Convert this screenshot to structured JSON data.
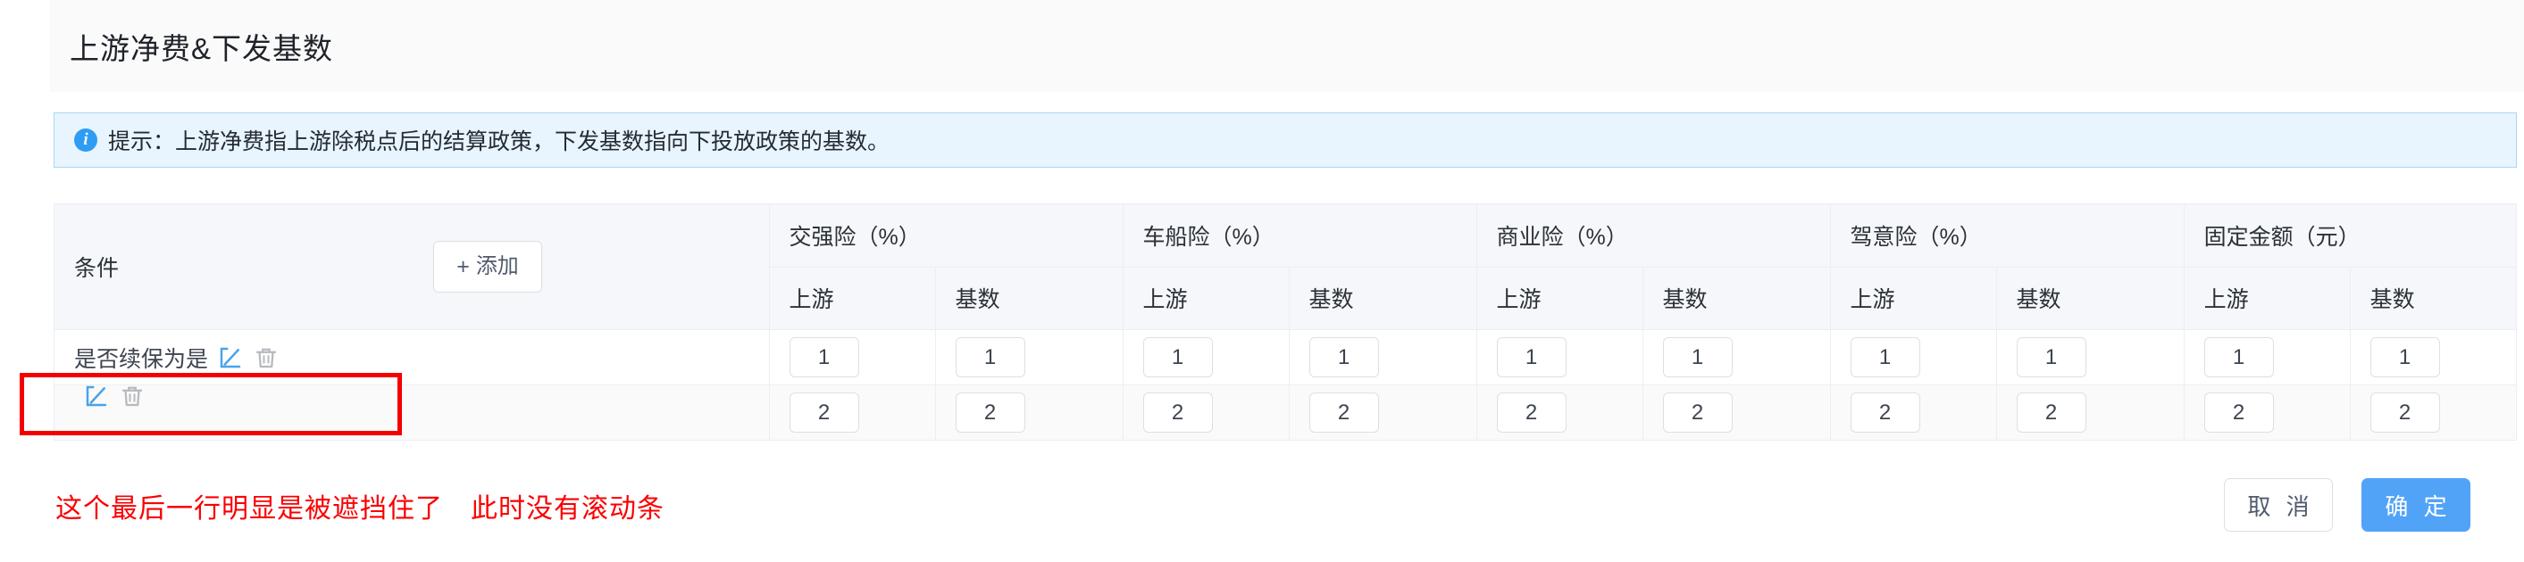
{
  "dialog": {
    "title": "上游净费&下发基数"
  },
  "banner": {
    "icon": "info-circle-icon",
    "text": "提示：上游净费指上游除税点后的结算政策，下发基数指向下投放政策的基数。"
  },
  "table": {
    "condition_column": {
      "label": "条件",
      "add_button": {
        "plus": "+",
        "label": "添加"
      }
    },
    "group_headers": [
      "交强险（%）",
      "车船险（%）",
      "商业险（%）",
      "驾意险（%）",
      "固定金额（元）"
    ],
    "sub_headers": [
      "上游",
      "基数"
    ],
    "sub_header_cells": [
      "上游",
      "基数",
      "上游",
      "基数",
      "上游",
      "基数",
      "上游",
      "基数",
      "上游",
      "基数"
    ],
    "rows": [
      {
        "condition": "是否续保为是",
        "edit_icon": "edit-pencil-icon",
        "delete_icon": "trash-icon",
        "values": [
          "1",
          "1",
          "1",
          "1",
          "1",
          "1",
          "1",
          "1",
          "1",
          "1"
        ]
      },
      {
        "condition": "",
        "edit_icon": "edit-pencil-icon",
        "delete_icon": "trash-icon",
        "values": [
          "2",
          "2",
          "2",
          "2",
          "2",
          "2",
          "2",
          "2",
          "2",
          "2"
        ]
      }
    ]
  },
  "annotation": {
    "note": "这个最后一行明显是被遮挡住了　此时没有滚动条",
    "box_color": "#f40000",
    "text_color": "#fa0000"
  },
  "footer": {
    "cancel_label": "取 消",
    "confirm_label": "确 定",
    "confirm_color": "#51a3f7"
  }
}
